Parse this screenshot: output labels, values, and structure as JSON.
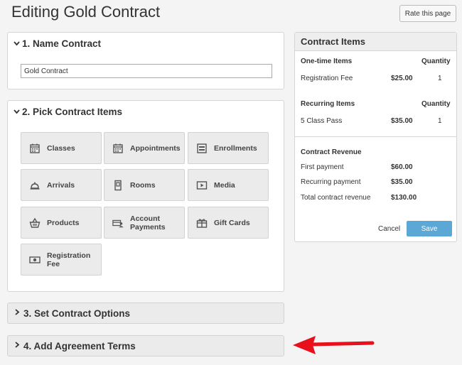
{
  "page": {
    "title": "Editing Gold Contract",
    "rate_label": "Rate this page"
  },
  "sections": {
    "name": {
      "title": "1. Name Contract",
      "input_value": "Gold Contract"
    },
    "pick": {
      "title": "2. Pick Contract Items",
      "items": [
        {
          "label": "Classes",
          "icon": "calendar-icon"
        },
        {
          "label": "Appointments",
          "icon": "calendar-icon"
        },
        {
          "label": "Enrollments",
          "icon": "list-icon"
        },
        {
          "label": "Arrivals",
          "icon": "bell-icon"
        },
        {
          "label": "Rooms",
          "icon": "door-icon"
        },
        {
          "label": "Media",
          "icon": "media-icon"
        },
        {
          "label": "Products",
          "icon": "basket-icon"
        },
        {
          "label": "Account Payments",
          "icon": "account-icon"
        },
        {
          "label": "Gift Cards",
          "icon": "gift-icon"
        },
        {
          "label": "Registration Fee",
          "icon": "money-icon"
        }
      ]
    },
    "options": {
      "title": "3. Set Contract Options"
    },
    "terms": {
      "title": "4. Add Agreement Terms"
    }
  },
  "summary": {
    "title": "Contract Items",
    "one_time_header": "One-time Items",
    "recurring_header": "Recurring Items",
    "quantity_header": "Quantity",
    "one_time": [
      {
        "name": "Registration Fee",
        "price": "$25.00",
        "qty": "1"
      }
    ],
    "recurring": [
      {
        "name": "5 Class Pass",
        "price": "$35.00",
        "qty": "1"
      }
    ],
    "revenue_header": "Contract Revenue",
    "revenue": [
      {
        "label": "First payment",
        "value": "$60.00"
      },
      {
        "label": "Recurring payment",
        "value": "$35.00"
      },
      {
        "label": "Total contract revenue",
        "value": "$130.00"
      }
    ],
    "cancel_label": "Cancel",
    "save_label": "Save"
  },
  "colors": {
    "accent": "#5ba7d6",
    "arrow": "#e8101a"
  }
}
